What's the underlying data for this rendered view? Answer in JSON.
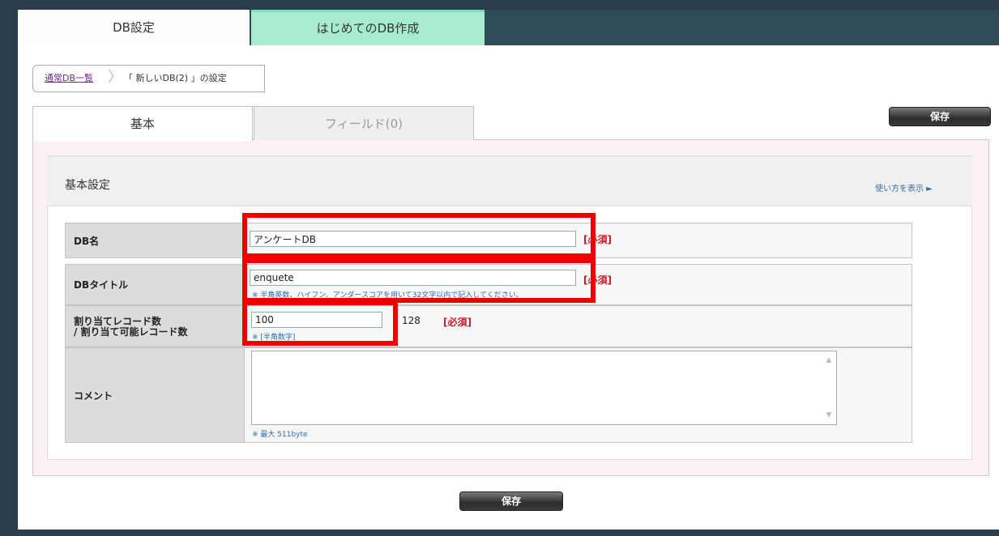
{
  "top_tabs": {
    "settings": "DB設定",
    "first_db": "はじめてのDB作成"
  },
  "breadcrumb": {
    "link": "通常DB一覧",
    "current": "「 新しいDB(2) 」の設定"
  },
  "main_tabs": {
    "basic": "基本",
    "fields": "フィールド(0)"
  },
  "buttons": {
    "save_top": "保存",
    "save_bottom": "保存"
  },
  "section": {
    "title": "基本設定",
    "usage_link": "使い方を表示 ►"
  },
  "form": {
    "db_name": {
      "label": "DB名",
      "value": "アンケートDB",
      "required": "[必須]"
    },
    "db_title": {
      "label": "DBタイトル",
      "value": "enquete",
      "required": "[必須]",
      "note": "※ 半角英数、ハイフン、アンダースコアを用いて32文字以内で記入してください。"
    },
    "record_count": {
      "label_line1": "割り当てレコード数",
      "label_line2": "/ 割り当て可能レコード数",
      "value": "100",
      "max_value": "128",
      "required": "[必須]",
      "note": "※ [半角数字]"
    },
    "comment": {
      "label": "コメント",
      "value": "",
      "note": "※ 最大 511byte"
    }
  },
  "colors": {
    "highlight": "#ee0000",
    "topbar": "#2e4c5a",
    "new_tab": "#a8ecd0",
    "required": "#c0202a"
  }
}
